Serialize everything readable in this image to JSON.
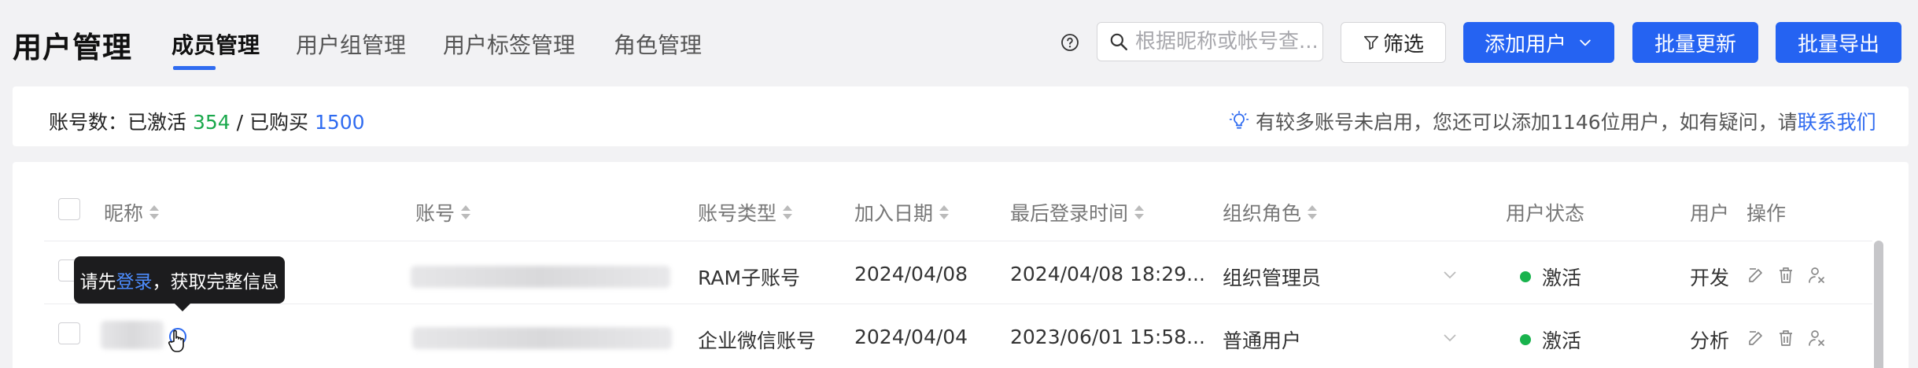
{
  "header": {
    "app_title": "用户管理",
    "tabs": [
      {
        "label": "成员管理",
        "active": true
      },
      {
        "label": "用户组管理",
        "active": false
      },
      {
        "label": "用户标签管理",
        "active": false
      },
      {
        "label": "角色管理",
        "active": false
      }
    ],
    "search_placeholder": "根据昵称或帐号查...",
    "filter_label": "筛选",
    "add_user_label": "添加用户",
    "batch_update_label": "批量更新",
    "batch_export_label": "批量导出"
  },
  "info_bar": {
    "account_label": "账号数：已激活",
    "activated": "354",
    "separator": "/ 已购买",
    "purchased": "1500",
    "tip_text": "有较多账号未启用，您还可以添加1146位用户，如有疑问，请",
    "contact_link": "联系我们"
  },
  "table": {
    "columns": [
      "昵称",
      "账号",
      "账号类型",
      "加入日期",
      "最后登录时间",
      "组织角色",
      "用户状态",
      "用户",
      "操作"
    ],
    "rows": [
      {
        "account_type": "RAM子账号",
        "join_date": "2024/04/08",
        "last_login": "2024/04/08 18:29...",
        "org_role": "组织管理员",
        "status": "激活",
        "user_group": "开发"
      },
      {
        "account_type": "企业微信账号",
        "join_date": "2024/04/04",
        "last_login": "2023/06/01 15:58...",
        "org_role": "普通用户",
        "status": "激活",
        "user_group": "分析"
      }
    ]
  },
  "tooltip": {
    "prefix": "请先",
    "link": "登录",
    "suffix": "，获取完整信息"
  },
  "colors": {
    "primary": "#2563f2",
    "active_green": "#19a84b",
    "link_blue": "#2f6bf0"
  }
}
